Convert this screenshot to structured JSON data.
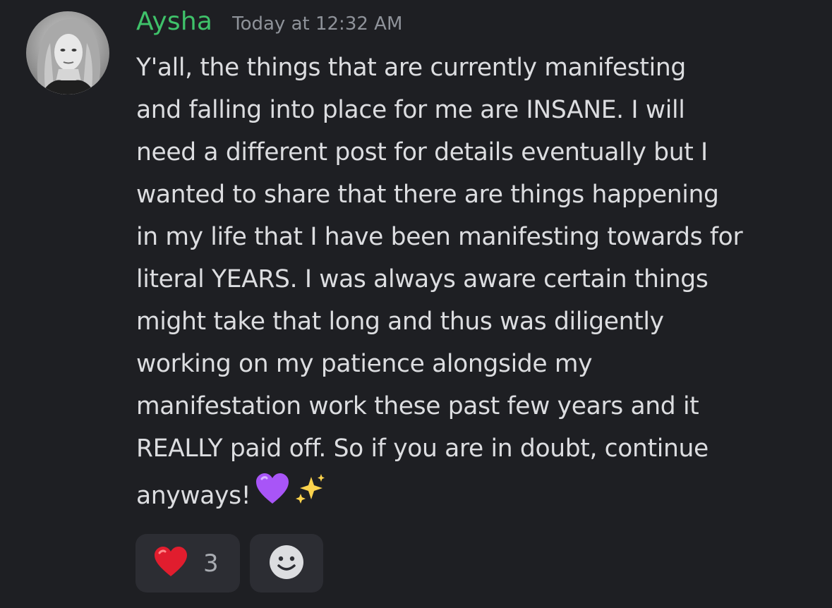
{
  "message": {
    "author": "Aysha",
    "timestamp": "Today at 12:32 AM",
    "author_color": "#3fc26a",
    "avatar_icon": "user-avatar-photo",
    "lines": [
      "Y'all, the things that are currently manifesting",
      "and falling into place for me are INSANE. I will",
      "need a different post for details eventually but I",
      "wanted to share that there are things happening",
      "in my life that I have been manifesting towards for",
      "literal YEARS. I was always aware certain things",
      "might take that long and thus was diligently",
      "working on my patience alongside my",
      "manifestation work these past few years and it",
      "REALLY paid off. So if you are in doubt, continue",
      "anyways!"
    ],
    "trailing_emojis": [
      "purple-heart-icon",
      "sparkles-icon"
    ]
  },
  "reactions": [
    {
      "emoji": "red-heart-icon",
      "count": "3"
    },
    {
      "emoji": "add-reaction-icon"
    }
  ],
  "colors": {
    "background": "#1e1f23",
    "text": "#dcdde0",
    "timestamp": "#8f939a",
    "reaction_bg": "#2c2d33"
  }
}
